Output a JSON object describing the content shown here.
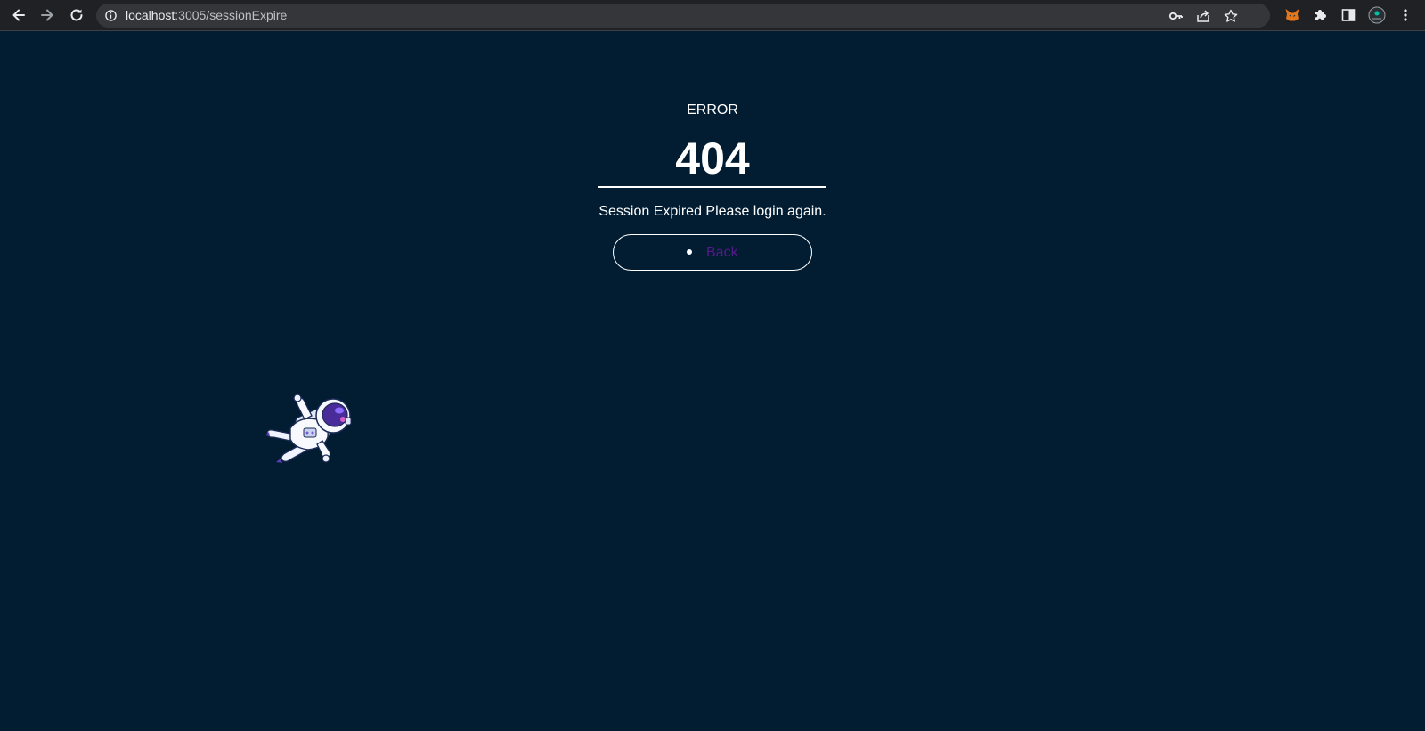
{
  "browser": {
    "url_host": "localhost",
    "url_rest": ":3005/sessionExpire"
  },
  "page": {
    "error_label": "ERROR",
    "error_code": "404",
    "message": "Session Expired Please login again.",
    "back_label": "Back"
  },
  "icons": {
    "back": "arrow-left-icon",
    "forward": "arrow-right-icon",
    "reload": "reload-icon",
    "info": "info-icon",
    "key": "key-icon",
    "share": "share-icon",
    "star": "star-icon",
    "metamask": "metamask-fox-icon",
    "extensions": "puzzle-icon",
    "side_panel": "side-panel-icon",
    "profile": "profile-avatar-icon",
    "menu": "kebab-menu-icon"
  },
  "colors": {
    "background": "#021d32",
    "link": "#551a8b",
    "text": "#ffffff"
  }
}
